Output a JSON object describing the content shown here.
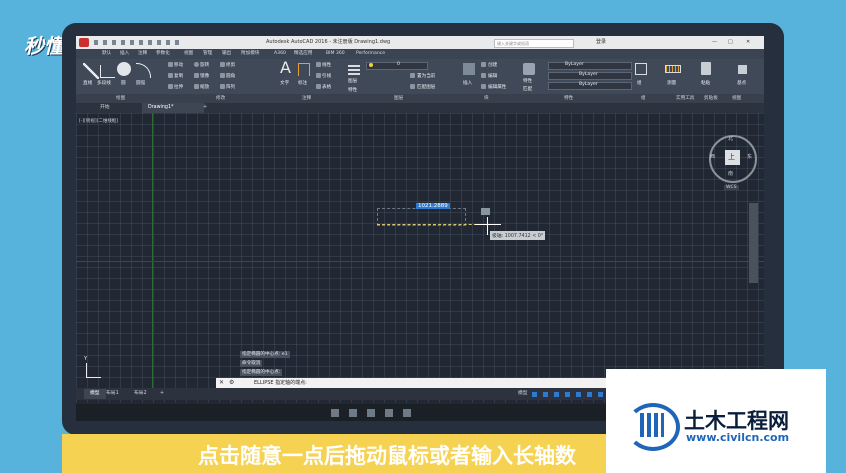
{
  "brand": {
    "logo_text": "秒懂视频"
  },
  "window": {
    "title": "Autodesk AutoCAD 2016 - 未注册版    Drawing1.dwg",
    "search_placeholder": "键入关键字或短语",
    "login": "登录"
  },
  "menubar": [
    "默认",
    "插入",
    "注释",
    "参数化",
    "视图",
    "管理",
    "输出",
    "附加模块",
    "A360",
    "精选应用",
    "BIM 360",
    "Performance"
  ],
  "ribbon": {
    "tools": [
      "直线",
      "多段线",
      "圆",
      "圆弧",
      "移动",
      "旋转",
      "修剪",
      "复制",
      "镜像",
      "圆角",
      "拉伸",
      "缩放",
      "阵列",
      "文字",
      "标注",
      "表格",
      "线性",
      "引线",
      "图层",
      "特性",
      "图层匹配",
      "置为当前",
      "匹配图层",
      "插入",
      "创建",
      "编辑",
      "编辑属性",
      "特性",
      "匹配",
      "组",
      "测量",
      "粘贴",
      "基点"
    ],
    "bylayer": "ByLayer",
    "layer_value": "0",
    "panels": [
      "绘图",
      "修改",
      "注释",
      "图层",
      "块",
      "特性",
      "组",
      "实用工具",
      "剪贴板",
      "视图"
    ]
  },
  "tabs": [
    "开始",
    "Drawing1*"
  ],
  "viewport": {
    "label": "[-][俯视][二维线框]",
    "input_value": "1021.2889",
    "tooltip": "极轴: 1007.7412 < 0°",
    "compass": {
      "n": "北",
      "s": "南",
      "e": "东",
      "w": "西",
      "top": "上"
    },
    "wcs": "WCS"
  },
  "command": {
    "history": [
      "指定椭圆的中心点: e1",
      "命令取消",
      "指定椭圆的中心点:"
    ],
    "prompt": "ELLIPSE 指定轴的端点:"
  },
  "layout_tabs": [
    "模型",
    "布局1",
    "布局2"
  ],
  "statusbar": {
    "model": "模型"
  },
  "subtitle": "点击随意一点后拖动鼠标或者输入长轴数",
  "watermark": {
    "name": "土木工程网",
    "url": "www.civilcn.com"
  },
  "colors": {
    "accent": "#f6d253",
    "background": "#57b3dc",
    "canvas": "#212833"
  }
}
